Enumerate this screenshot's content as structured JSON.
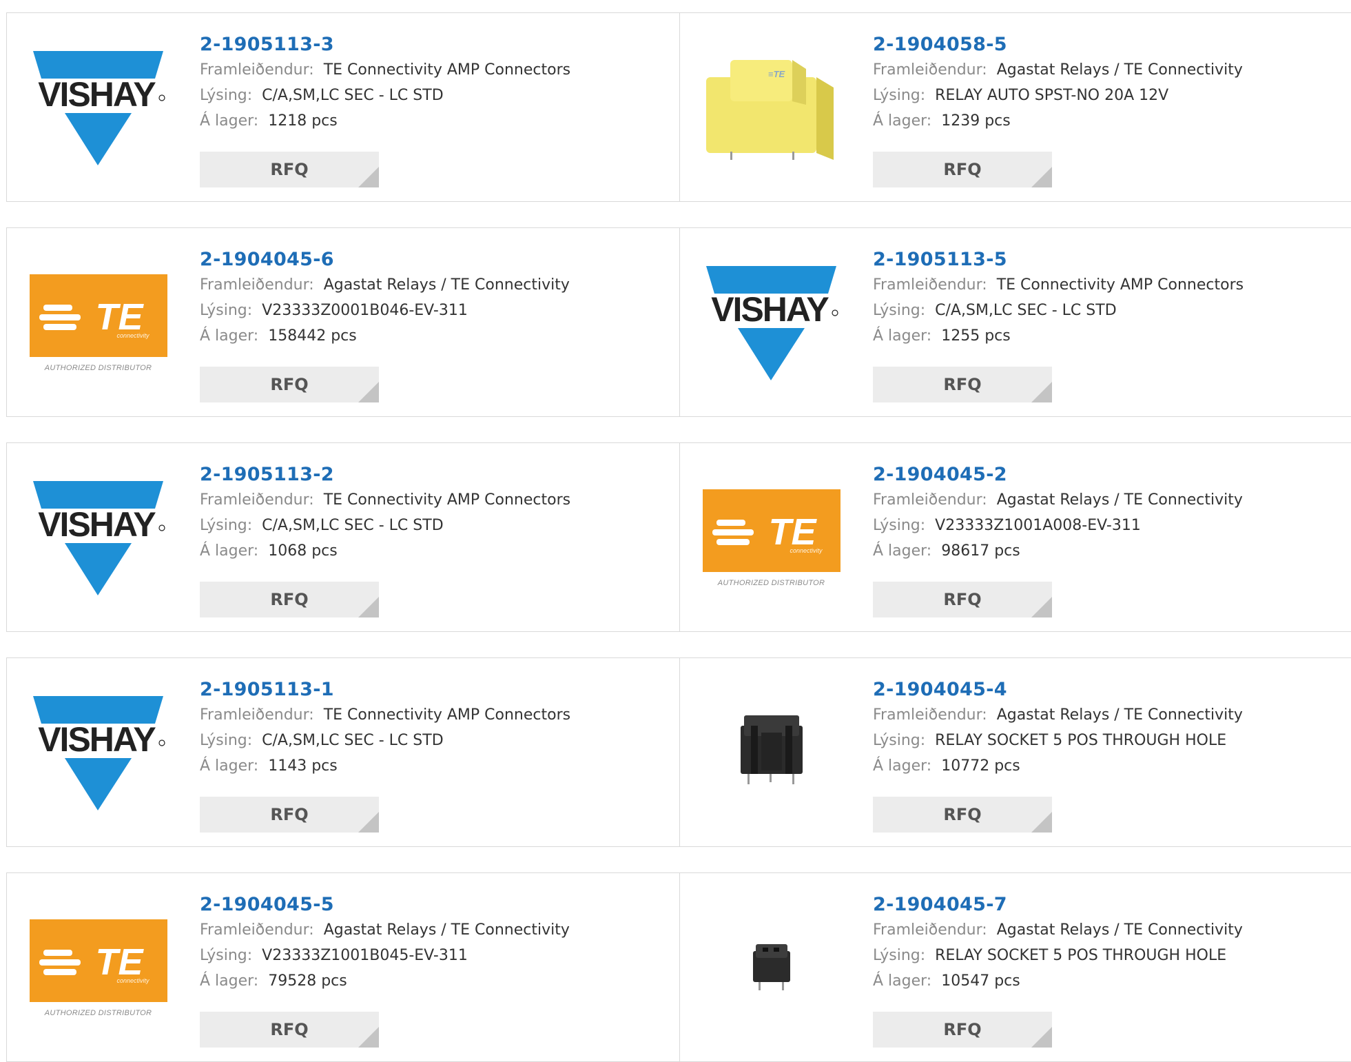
{
  "labels": {
    "manufacturer": "Framleiðendur:",
    "description": "Lýsing:",
    "stock": "Á lager:",
    "rfq": "RFQ"
  },
  "colors": {
    "part_link": "#1e6db6",
    "vishay_blue": "#1e90d6",
    "te_orange": "#f39c1f"
  },
  "logos": {
    "vishay": "VISHAY",
    "te": "TE",
    "te_sub": "connectivity",
    "te_authorized": "AUTHORIZED DISTRIBUTOR"
  },
  "products": [
    {
      "part": "2-1905113-3",
      "manufacturer": "TE Connectivity AMP Connectors",
      "description": "C/A,SM,LC SEC - LC STD",
      "stock": "1218 pcs",
      "image": "vishay-logo"
    },
    {
      "part": "2-1904058-5",
      "manufacturer": "Agastat Relays / TE Connectivity",
      "description": "RELAY AUTO SPST-NO 20A 12V",
      "stock": "1239 pcs",
      "image": "yellow-relay-photo"
    },
    {
      "part": "2-1904045-6",
      "manufacturer": "Agastat Relays / TE Connectivity",
      "description": "V23333Z0001B046-EV-311",
      "stock": "158442 pcs",
      "image": "te-logo"
    },
    {
      "part": "2-1905113-5",
      "manufacturer": "TE Connectivity AMP Connectors",
      "description": "C/A,SM,LC SEC - LC STD",
      "stock": "1255 pcs",
      "image": "vishay-logo"
    },
    {
      "part": "2-1905113-2",
      "manufacturer": "TE Connectivity AMP Connectors",
      "description": "C/A,SM,LC SEC - LC STD",
      "stock": "1068 pcs",
      "image": "vishay-logo"
    },
    {
      "part": "2-1904045-2",
      "manufacturer": "Agastat Relays / TE Connectivity",
      "description": "V23333Z1001A008-EV-311",
      "stock": "98617 pcs",
      "image": "te-logo"
    },
    {
      "part": "2-1905113-1",
      "manufacturer": "TE Connectivity AMP Connectors",
      "description": "C/A,SM,LC SEC - LC STD",
      "stock": "1143 pcs",
      "image": "vishay-logo"
    },
    {
      "part": "2-1904045-4",
      "manufacturer": "Agastat Relays / TE Connectivity",
      "description": "RELAY SOCKET 5 POS THROUGH HOLE",
      "stock": "10772 pcs",
      "image": "black-socket-large-photo"
    },
    {
      "part": "2-1904045-5",
      "manufacturer": "Agastat Relays / TE Connectivity",
      "description": "V23333Z1001B045-EV-311",
      "stock": "79528 pcs",
      "image": "te-logo"
    },
    {
      "part": "2-1904045-7",
      "manufacturer": "Agastat Relays / TE Connectivity",
      "description": "RELAY SOCKET 5 POS THROUGH HOLE",
      "stock": "10547 pcs",
      "image": "black-socket-small-photo"
    }
  ]
}
